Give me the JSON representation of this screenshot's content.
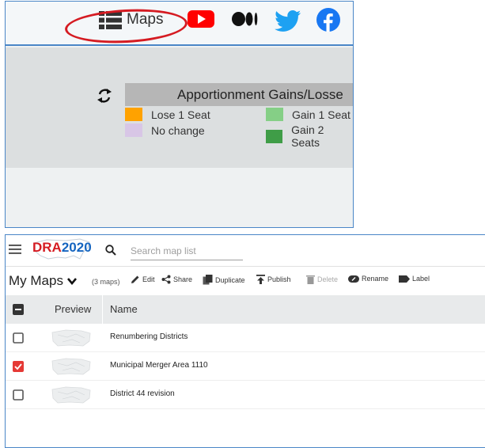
{
  "top_bar": {
    "maps_label": "Maps",
    "icons": [
      "list-icon",
      "youtube-icon",
      "medium-icon",
      "twitter-icon",
      "facebook-icon"
    ]
  },
  "legend": {
    "title": "Apportionment Gains/Losse",
    "items": [
      {
        "label": "Lose 1 Seat",
        "color": "#ffa200"
      },
      {
        "label": "No change",
        "color": "#d8c6e6"
      },
      {
        "label": "Gain 1 Seat",
        "color": "#85cf86"
      },
      {
        "label": "Gain 2 Seats",
        "color": "#3f9d47"
      }
    ]
  },
  "header": {
    "logo_dra": "DRA",
    "logo_year": "2020",
    "search_placeholder": "Search map list"
  },
  "toolbar": {
    "title": "My Maps",
    "count": "(3 maps)",
    "actions": {
      "edit": "Edit",
      "share": "Share",
      "duplicate": "Duplicate",
      "publish": "Publish",
      "delete": "Delete",
      "rename": "Rename",
      "label": "Label"
    }
  },
  "table": {
    "columns": {
      "preview": "Preview",
      "name": "Name"
    },
    "rows": [
      {
        "name": "Renumbering Districts",
        "checked": false
      },
      {
        "name": "Municipal Merger Area 1110",
        "checked": true
      },
      {
        "name": "District 44 revision",
        "checked": false
      }
    ]
  },
  "colors": {
    "accent_blue": "#4a86c7",
    "annotation_red": "#d51b22",
    "checked_red": "#e53935",
    "youtube_red": "#ff0000",
    "twitter_blue": "#1da1f2",
    "facebook_blue": "#1877f2"
  }
}
